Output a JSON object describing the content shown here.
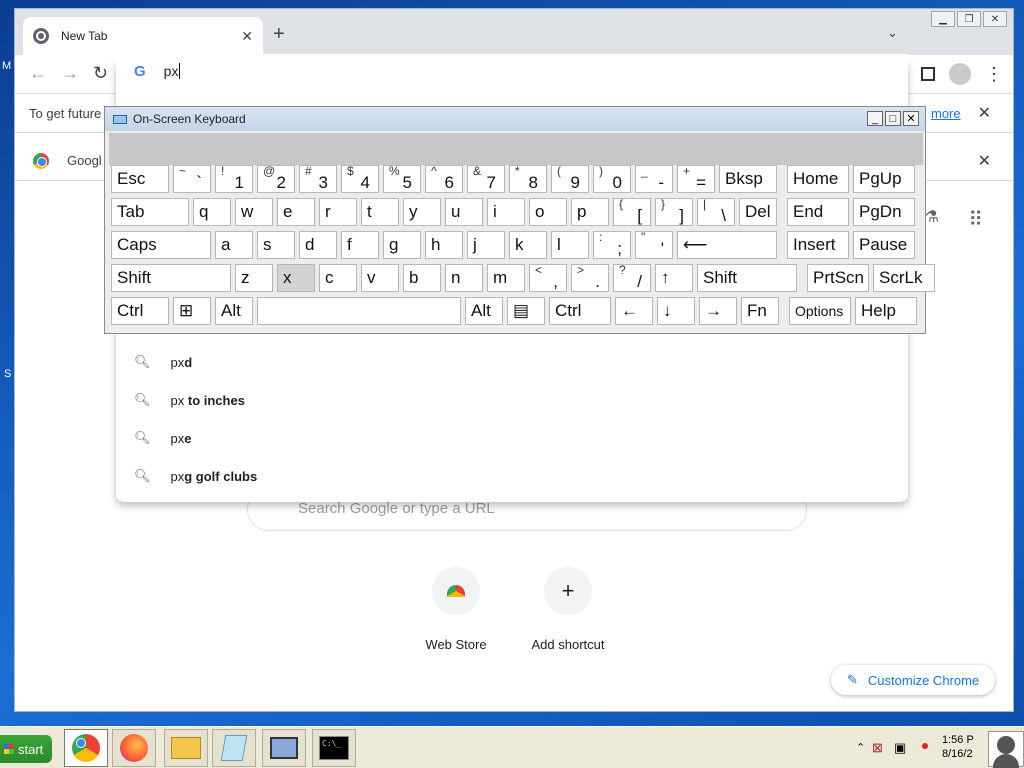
{
  "browser": {
    "tab_title": "New Tab",
    "omnibox_text": "px",
    "infobar_text": "To get future",
    "infobar_link": "more",
    "bookmark_text": "Googl",
    "suggestions": [
      {
        "prefix": "px",
        "bold": "d"
      },
      {
        "prefix": "px",
        "bold": " to inches"
      },
      {
        "prefix": "px",
        "bold": "e"
      },
      {
        "prefix": "px",
        "bold": "g golf clubs"
      }
    ],
    "search_placeholder": "Search Google or type a URL",
    "shortcuts": [
      {
        "label": "Web Store",
        "icon": "webstore-icon"
      },
      {
        "label": "Add shortcut",
        "icon": "plus-icon"
      }
    ],
    "customize_label": "Customize Chrome"
  },
  "osk": {
    "title": "On-Screen Keyboard",
    "rows": [
      [
        {
          "k": "Esc"
        },
        {
          "s": "~",
          "p": "`"
        },
        {
          "s": "!",
          "p": "1"
        },
        {
          "s": "@",
          "p": "2"
        },
        {
          "s": "#",
          "p": "3"
        },
        {
          "s": "$",
          "p": "4"
        },
        {
          "s": "%",
          "p": "5"
        },
        {
          "s": "^",
          "p": "6"
        },
        {
          "s": "&",
          "p": "7"
        },
        {
          "s": "*",
          "p": "8"
        },
        {
          "s": "(",
          "p": "9"
        },
        {
          "s": ")",
          "p": "0"
        },
        {
          "s": "_",
          "p": "-"
        },
        {
          "s": "+",
          "p": "="
        },
        {
          "k": "Bksp"
        },
        {
          "k": "Home"
        },
        {
          "k": "PgUp"
        }
      ],
      [
        {
          "k": "Tab"
        },
        {
          "k": "q"
        },
        {
          "k": "w"
        },
        {
          "k": "e"
        },
        {
          "k": "r"
        },
        {
          "k": "t"
        },
        {
          "k": "y"
        },
        {
          "k": "u"
        },
        {
          "k": "i"
        },
        {
          "k": "o"
        },
        {
          "k": "p"
        },
        {
          "s": "{",
          "p": "["
        },
        {
          "s": "}",
          "p": "]"
        },
        {
          "s": "|",
          "p": "\\"
        },
        {
          "k": "Del"
        },
        {
          "k": "End"
        },
        {
          "k": "PgDn"
        }
      ],
      [
        {
          "k": "Caps"
        },
        {
          "k": "a"
        },
        {
          "k": "s"
        },
        {
          "k": "d"
        },
        {
          "k": "f"
        },
        {
          "k": "g"
        },
        {
          "k": "h"
        },
        {
          "k": "j"
        },
        {
          "k": "k"
        },
        {
          "k": "l"
        },
        {
          "s": ":",
          "p": ";"
        },
        {
          "s": "\"",
          "p": "'"
        },
        {
          "k": "⟵"
        },
        {
          "k": "Insert"
        },
        {
          "k": "Pause"
        }
      ],
      [
        {
          "k": "Shift"
        },
        {
          "k": "z"
        },
        {
          "k": "x"
        },
        {
          "k": "c"
        },
        {
          "k": "v"
        },
        {
          "k": "b"
        },
        {
          "k": "n"
        },
        {
          "k": "m"
        },
        {
          "s": "<",
          "p": ","
        },
        {
          "s": ">",
          "p": "."
        },
        {
          "s": "?",
          "p": "/"
        },
        {
          "k": "↑"
        },
        {
          "k": "Shift"
        },
        {
          "k": "PrtScn"
        },
        {
          "k": "ScrLk"
        }
      ],
      [
        {
          "k": "Ctrl"
        },
        {
          "k": "⊞"
        },
        {
          "k": "Alt"
        },
        {
          "k": ""
        },
        {
          "k": "Alt"
        },
        {
          "k": "▤"
        },
        {
          "k": "Ctrl"
        },
        {
          "k": "←"
        },
        {
          "k": "↓"
        },
        {
          "k": "→"
        },
        {
          "k": "Fn"
        },
        {
          "k": "Options"
        },
        {
          "k": "Help"
        }
      ]
    ],
    "hovered_key": "x"
  },
  "taskbar": {
    "start_label": "start",
    "clock_time": "1:56 P",
    "clock_date": "8/16/2"
  },
  "colors": {
    "accent": "#1a73e8",
    "desktop": "#1560c0"
  }
}
